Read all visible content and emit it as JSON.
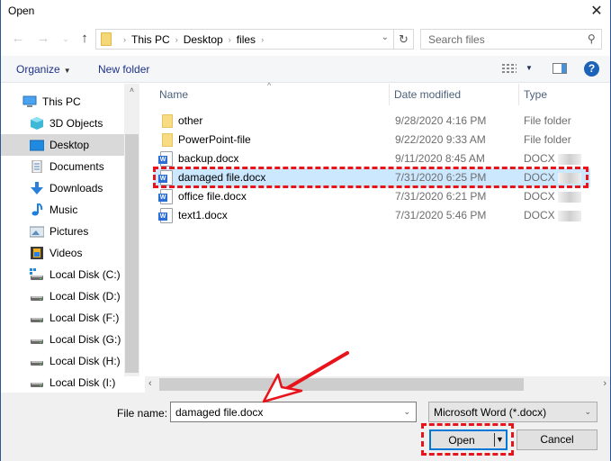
{
  "window": {
    "title": "Open",
    "close_label": "✕"
  },
  "nav": {
    "back_icon": "←",
    "forward_icon": "→",
    "recent_icon": "⌄",
    "up_icon": "↑",
    "breadcrumbs": [
      "This PC",
      "Desktop",
      "files"
    ],
    "crumb_separator": "›",
    "dropdown_icon": "⌄",
    "refresh_icon": "↻",
    "search_placeholder": "Search files",
    "search_icon": "⚲"
  },
  "toolbar": {
    "organize_label": "Organize",
    "organize_caret": "▼",
    "new_folder_label": "New folder",
    "view_dropdown_caret": "▼",
    "help_label": "?"
  },
  "sidebar": {
    "scroll_up": "˄",
    "scroll_down": "˅",
    "items": [
      {
        "label": "This PC",
        "icon": "computer-icon",
        "indent": 0,
        "selected": false
      },
      {
        "label": "3D Objects",
        "icon": "cube-icon",
        "indent": 1,
        "selected": false
      },
      {
        "label": "Desktop",
        "icon": "desktop-icon",
        "indent": 1,
        "selected": true
      },
      {
        "label": "Documents",
        "icon": "document-icon",
        "indent": 1,
        "selected": false
      },
      {
        "label": "Downloads",
        "icon": "download-icon",
        "indent": 1,
        "selected": false
      },
      {
        "label": "Music",
        "icon": "music-icon",
        "indent": 1,
        "selected": false
      },
      {
        "label": "Pictures",
        "icon": "pictures-icon",
        "indent": 1,
        "selected": false
      },
      {
        "label": "Videos",
        "icon": "videos-icon",
        "indent": 1,
        "selected": false
      },
      {
        "label": "Local Disk (C:)",
        "icon": "system-drive-icon",
        "indent": 1,
        "selected": false
      },
      {
        "label": "Local Disk (D:)",
        "icon": "drive-icon",
        "indent": 1,
        "selected": false
      },
      {
        "label": "Local Disk (F:)",
        "icon": "drive-icon",
        "indent": 1,
        "selected": false
      },
      {
        "label": "Local Disk (G:)",
        "icon": "drive-icon",
        "indent": 1,
        "selected": false
      },
      {
        "label": "Local Disk (H:)",
        "icon": "drive-icon",
        "indent": 1,
        "selected": false
      },
      {
        "label": "Local Disk (I:)",
        "icon": "drive-icon",
        "indent": 1,
        "selected": false
      }
    ]
  },
  "files": {
    "columns": {
      "name": "Name",
      "date": "Date modified",
      "type": "Type"
    },
    "sort_indicator": "^",
    "rows": [
      {
        "name": "other",
        "date": "9/28/2020 4:16 PM",
        "type": "File folder",
        "kind": "folder",
        "selected": false
      },
      {
        "name": "PowerPoint-file",
        "date": "9/22/2020 9:33 AM",
        "type": "File folder",
        "kind": "folder",
        "selected": false
      },
      {
        "name": "backup.docx",
        "date": "9/11/2020 8:45 AM",
        "type": "DOCX",
        "kind": "docx",
        "selected": false
      },
      {
        "name": "damaged file.docx",
        "date": "7/31/2020 6:25 PM",
        "type": "DOCX",
        "kind": "docx",
        "selected": true
      },
      {
        "name": "office file.docx",
        "date": "7/31/2020 6:21 PM",
        "type": "DOCX",
        "kind": "docx",
        "selected": false
      },
      {
        "name": "text1.docx",
        "date": "7/31/2020 5:46 PM",
        "type": "DOCX",
        "kind": "docx",
        "selected": false
      }
    ],
    "hscroll_left": "‹",
    "hscroll_right": "›"
  },
  "footer": {
    "file_name_label": "File name:",
    "file_name_value": "damaged file.docx",
    "file_name_dropdown": "⌄",
    "file_type_value": "Microsoft Word (*.docx)",
    "file_type_dropdown": "⌄",
    "open_label": "Open",
    "open_split_arrow": "▼",
    "cancel_label": "Cancel"
  },
  "annotations": {
    "color": "#e8141c"
  }
}
